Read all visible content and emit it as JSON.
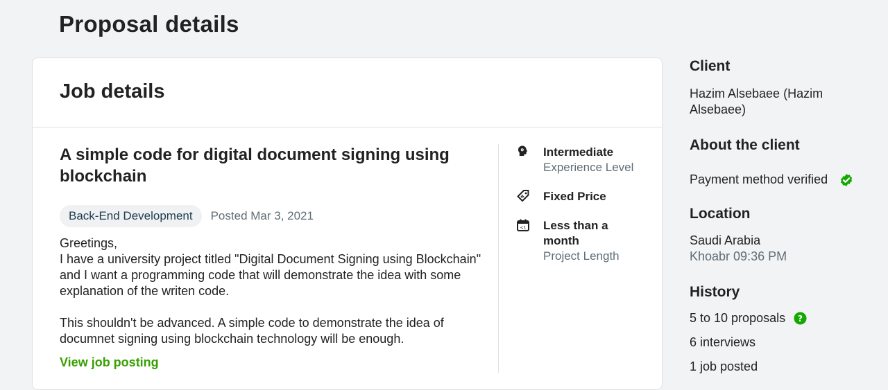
{
  "page": {
    "title": "Proposal details"
  },
  "job_card": {
    "header": "Job details",
    "title": "A simple code for digital document signing using blockchain",
    "category": "Back-End Development",
    "posted": "Posted Mar 3, 2021",
    "description": [
      "Greetings,",
      "I have a university project titled \"Digital Document Signing using Blockchain\" and I want a programming code that will demonstrate the idea with some explanation of the writen code.",
      "",
      "This shouldn't be advanced. A simple code to demonstrate the idea of documnet signing using blockchain technology will be enough."
    ],
    "view_link": "View job posting",
    "features": [
      {
        "icon": "experience-level-icon",
        "value": "Intermediate",
        "label": "Experience Level"
      },
      {
        "icon": "price-tag-icon",
        "value": "Fixed Price",
        "label": ""
      },
      {
        "icon": "calendar-icon",
        "value": "Less than a month",
        "label": "Project Length"
      }
    ]
  },
  "client": {
    "heading": "Client",
    "name": "Hazim Alsebaee (Hazim Alsebaee)",
    "about_heading": "About the client",
    "payment": "Payment method verified",
    "location_heading": "Location",
    "country": "Saudi Arabia",
    "local_time": "Khoabr 09:36 PM",
    "history_heading": "History",
    "proposals": "5 to 10 proposals",
    "interviews": "6 interviews",
    "jobs_posted": "1 job posted"
  },
  "colors": {
    "accent_green": "#37a000",
    "verified_green": "#14a800",
    "muted_text": "#5e6d76"
  }
}
